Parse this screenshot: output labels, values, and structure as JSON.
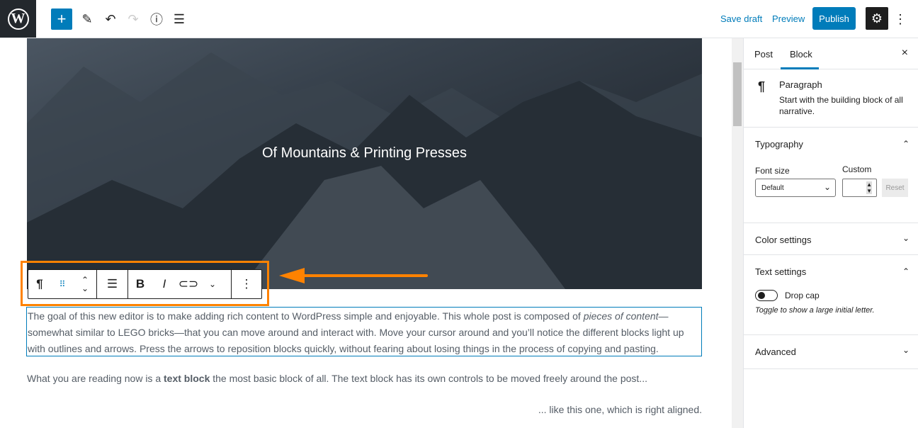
{
  "header": {
    "logo": "W",
    "tools": [
      "plus-icon",
      "pencil-icon",
      "undo-icon",
      "redo-icon",
      "info-icon",
      "list-view-icon"
    ],
    "save_draft": "Save draft",
    "preview": "Preview",
    "publish": "Publish",
    "accent": "#007cba"
  },
  "cover": {
    "title": "Of Mountains & Printing Presses"
  },
  "content": {
    "p1_a": "The goal of this new editor is to make adding rich content to WordPress simple and enjoyable. This whole post is composed of ",
    "p1_em": "pieces of content",
    "p1_b": "—somewhat similar to LEGO bricks—that you can move around and interact with. Move your cursor around and you’ll notice the different blocks light up with outlines and arrows. Press the arrows to reposition blocks quickly, without fearing about losing things in the process of copying and pasting.",
    "p2_a": "What you are reading now is a ",
    "p2_strong": "text block",
    "p2_b": " the most basic block of all. The text block has its own controls to be moved freely around the post...",
    "p3": "... like this one, which is right aligned."
  },
  "block_toolbar": {
    "items": [
      "paragraph-icon",
      "drag-handle-icon",
      "move-up-down-icon",
      "align-icon",
      "bold-icon",
      "italic-icon",
      "link-icon",
      "more-rich-text-chevron-icon",
      "more-options-icon"
    ],
    "highlight_color": "#ff8200"
  },
  "sidebar": {
    "tabs": [
      "Post",
      "Block"
    ],
    "active_tab": "Block",
    "block_name": "Paragraph",
    "block_desc": "Start with the building block of all narrative.",
    "typography": "Typography",
    "font_size_label": "Font size",
    "custom_label": "Custom",
    "font_size_value": "Default",
    "reset": "Reset",
    "color_settings": "Color settings",
    "text_settings": "Text settings",
    "drop_cap": "Drop cap",
    "drop_cap_help": "Toggle to show a large initial letter.",
    "drop_cap_on": false,
    "advanced": "Advanced"
  }
}
